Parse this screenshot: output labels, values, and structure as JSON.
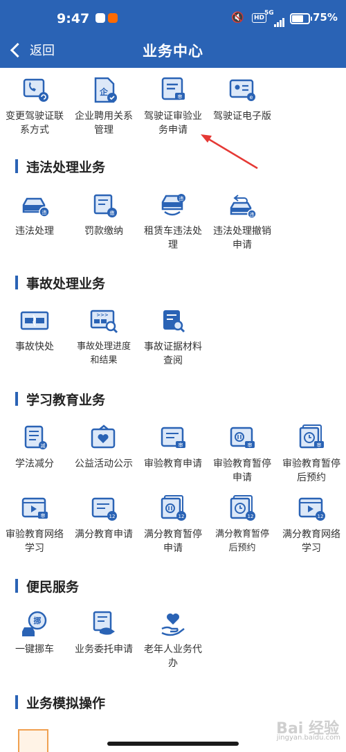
{
  "status_bar": {
    "time": "9:47",
    "network": "5G",
    "hd": "HD",
    "battery": "75%",
    "battery_level": 0.75
  },
  "header": {
    "back_label": "返回",
    "title": "业务中心"
  },
  "top_tiles": [
    {
      "label": "变更驾驶证联系方式",
      "icon": "phone-card-icon"
    },
    {
      "label": "企业聘用关系管理",
      "icon": "company-doc-icon"
    },
    {
      "label": "驾驶证审验业务申请",
      "icon": "license-review-icon"
    },
    {
      "label": "驾驶证电子版",
      "icon": "e-license-icon"
    }
  ],
  "sections": [
    {
      "title": "违法处理业务",
      "tiles": [
        {
          "label": "违法处理",
          "icon": "car-violation-icon"
        },
        {
          "label": "罚款缴纳",
          "icon": "fine-payment-icon"
        },
        {
          "label": "租赁车违法处理",
          "icon": "rental-car-icon"
        },
        {
          "label": "违法处理撤销申请",
          "icon": "car-undo-icon"
        }
      ]
    },
    {
      "title": "事故处理业务",
      "tiles": [
        {
          "label": "事故快处",
          "icon": "accident-quick-icon"
        },
        {
          "label": "事故处理进度和结果",
          "icon": "accident-progress-icon"
        },
        {
          "label": "事故证据材料查阅",
          "icon": "evidence-search-icon"
        }
      ]
    },
    {
      "title": "学习教育业务",
      "tiles": [
        {
          "label": "学法减分",
          "icon": "study-book-icon"
        },
        {
          "label": "公益活动公示",
          "icon": "charity-heart-icon"
        },
        {
          "label": "审验教育申请",
          "icon": "review-edu-icon"
        },
        {
          "label": "审验教育暂停申请",
          "icon": "pause-doc-icon"
        },
        {
          "label": "审验教育暂停后预约",
          "icon": "clock-doc-icon"
        },
        {
          "label": "审验教育网络学习",
          "icon": "video-learn-icon"
        },
        {
          "label": "满分教育申请",
          "icon": "full-score-doc-icon"
        },
        {
          "label": "满分教育暂停申请",
          "icon": "full-pause-icon"
        },
        {
          "label": "满分教育暂停后预约",
          "icon": "full-clock-icon"
        },
        {
          "label": "满分教育网络学习",
          "icon": "full-video-icon"
        }
      ]
    },
    {
      "title": "便民服务",
      "tiles": [
        {
          "label": "一键挪车",
          "icon": "move-car-icon"
        },
        {
          "label": "业务委托申请",
          "icon": "delegate-doc-icon"
        },
        {
          "label": "老年人业务代办",
          "icon": "elder-care-icon"
        }
      ]
    },
    {
      "title": "业务模拟操作",
      "tiles": []
    }
  ],
  "badges": {
    "review": "审",
    "fine": "缴",
    "violation": "违",
    "company": "企",
    "score12": "12",
    "move": "挪",
    "reduce": "减"
  },
  "watermark": {
    "logo": "Bai 经验",
    "site": "jingyan.baidu.com"
  },
  "colors": {
    "header": "#2a63b5",
    "icon_blue": "#2a63b5",
    "icon_light": "#dce8f8",
    "annotation_red": "#e53935"
  }
}
